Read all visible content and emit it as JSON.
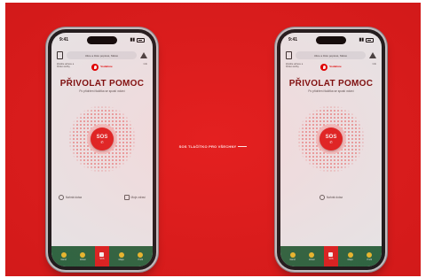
{
  "caption": "SOS TLAČÍTKO PRO VŠECHNY",
  "phones": [
    {
      "status_time": "9:41",
      "address": "Ulice a číslo popisné, Město",
      "left_sub": "Zjistěte adresu a blízké služby",
      "brand": "Vodafone",
      "right_sub": "Info",
      "title": "PŘIVOLAT POMOC",
      "subtitle": "Po přidržení tlačítka se spustí volání",
      "sos_label": "SOS",
      "action_left": "Nahrát dotaz",
      "action_right": "Moje zdraví",
      "tabs": [
        "Domů",
        "Zdraví",
        "SOS",
        "Mapa",
        "Profil"
      ]
    },
    {
      "status_time": "9:41",
      "address": "Ulice a číslo popisné, Město",
      "left_sub": "Zjistěte adresu a blízké služby",
      "brand": "Vodafone",
      "right_sub": "Info",
      "title": "PŘIVOLAT POMOC",
      "subtitle": "Po přidržení tlačítka se spustí volání",
      "sos_label": "SOS",
      "action_center": "Nahrát dotaz",
      "tabs": [
        "Domů",
        "Zdraví",
        "SOS",
        "Mapa",
        "Profil"
      ]
    }
  ],
  "colors": {
    "background": "#df1b1b",
    "sos": "#e22424",
    "tabbar": "#2d6b45",
    "title": "#7a0c0c"
  }
}
